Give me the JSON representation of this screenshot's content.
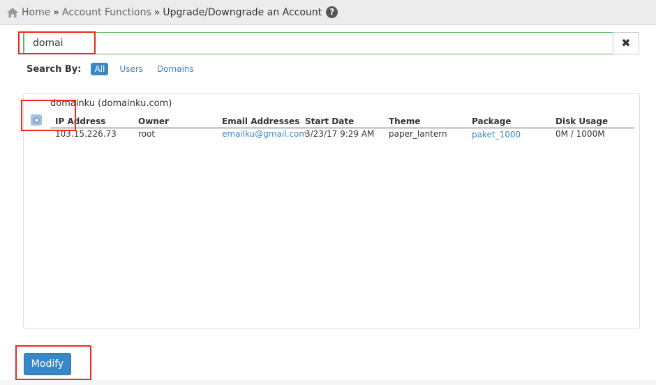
{
  "breadcrumb": {
    "home": "Home",
    "section": "Account Functions",
    "current": "Upgrade/Downgrade an Account",
    "separator": "»",
    "help": "?"
  },
  "search": {
    "value": "domai",
    "clear": "✖"
  },
  "search_by": {
    "label": "Search By:",
    "options": [
      {
        "label": "All",
        "active": true
      },
      {
        "label": "Users",
        "active": false
      },
      {
        "label": "Domains",
        "active": false
      }
    ]
  },
  "results": {
    "account_title": "domainku (domainku.com)",
    "columns": [
      "IP Address",
      "Owner",
      "Email Addresses",
      "Start Date",
      "Theme",
      "Package",
      "Disk Usage"
    ],
    "row": {
      "ip": "103.15.226.73",
      "owner": "root",
      "email": "emailku@gmail.com",
      "start_date": "3/23/17 9:29 AM",
      "theme": "paper_lantern",
      "package": "paket_1000",
      "disk_usage": "0M / 1000M"
    }
  },
  "actions": {
    "modify": "Modify"
  },
  "colors": {
    "accent": "#3a87c8",
    "focus_border": "#5cb85c",
    "annotation": "#f0281e"
  }
}
